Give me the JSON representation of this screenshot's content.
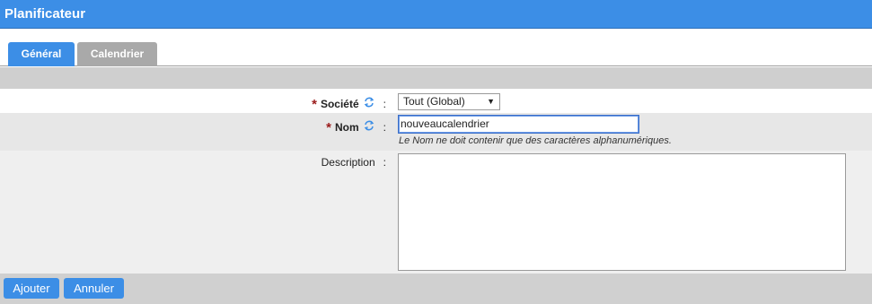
{
  "header": {
    "title": "Planificateur"
  },
  "tabs": [
    {
      "label": "Général",
      "active": true
    },
    {
      "label": "Calendrier",
      "active": false
    }
  ],
  "form": {
    "societe": {
      "label": "Société",
      "required": true,
      "value": "Tout (Global)"
    },
    "nom": {
      "label": "Nom",
      "required": true,
      "value": "nouveaucalendrier",
      "help": "Le Nom ne doit contenir que des caractères alphanumériques."
    },
    "description": {
      "label": "Description",
      "value": ""
    },
    "colon": ":",
    "required_marker": "*"
  },
  "footer": {
    "save_label": "Ajouter",
    "cancel_label": "Annuler"
  },
  "colors": {
    "accent": "#3c8ee6",
    "inactive_tab": "#a9a9a9",
    "required": "#9b1c1c"
  }
}
